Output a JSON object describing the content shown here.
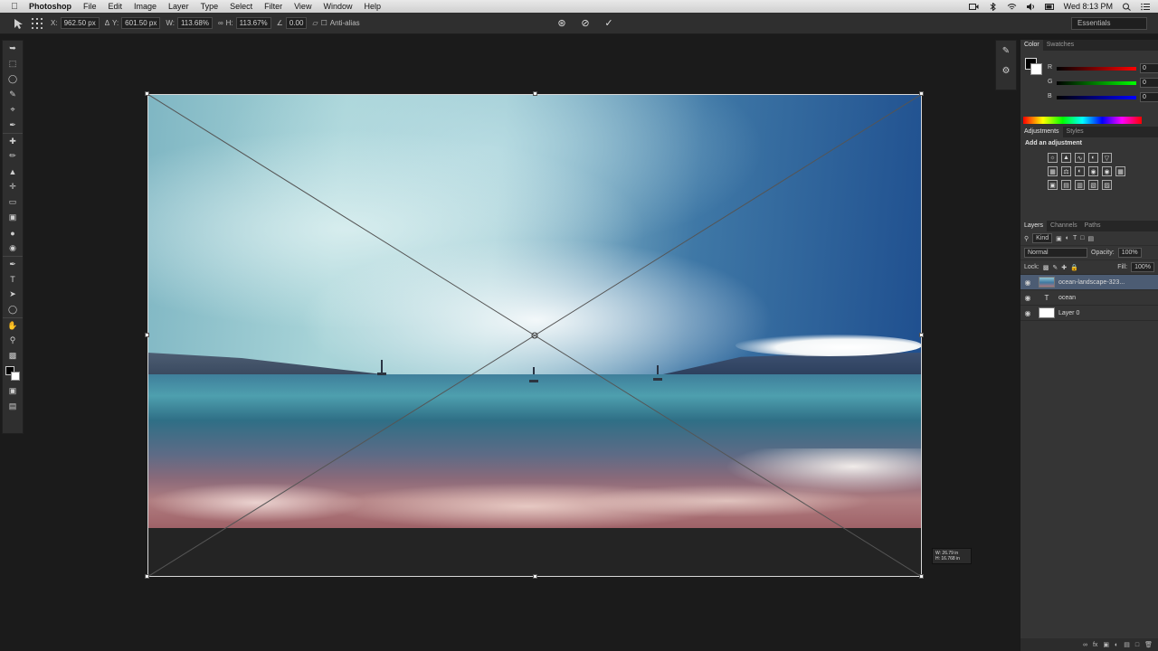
{
  "menubar": {
    "apple": "",
    "items": [
      "Photoshop",
      "File",
      "Edit",
      "Image",
      "Layer",
      "Type",
      "Select",
      "Filter",
      "View",
      "Window",
      "Help"
    ],
    "clock": "Wed 8:13 PM"
  },
  "options": {
    "x_label": "X:",
    "x_value": "962.50 px",
    "y_label": "Y:",
    "y_value": "601.50 px",
    "w_label": "W:",
    "w_value": "113.68%",
    "h_label": "H:",
    "h_value": "113.67%",
    "angle_value": "0.00",
    "antialias_label": "Anti-alias",
    "workspace": "Essentials"
  },
  "readout": {
    "line1": "W: 26.79 in",
    "line2": "H: 16.768 in"
  },
  "color_panel": {
    "tabs": [
      "Color",
      "Swatches"
    ],
    "rows": [
      {
        "label": "R",
        "value": "0",
        "gradient": "linear-gradient(90deg,#000,#ff0000)"
      },
      {
        "label": "G",
        "value": "0",
        "gradient": "linear-gradient(90deg,#000,#00ff00)"
      },
      {
        "label": "B",
        "value": "0",
        "gradient": "linear-gradient(90deg,#000,#0000ff)"
      }
    ]
  },
  "adjustments_panel": {
    "tabs": [
      "Adjustments",
      "Styles"
    ],
    "title": "Add an adjustment"
  },
  "layers_panel": {
    "tabs": [
      "Layers",
      "Channels",
      "Paths"
    ],
    "kind": "Kind",
    "blend_mode": "Normal",
    "opacity_label": "Opacity:",
    "opacity_value": "100%",
    "lock_label": "Lock:",
    "fill_label": "Fill:",
    "fill_value": "100%",
    "layers": [
      {
        "name": "ocean-landscape-323...",
        "type": "image",
        "selected": true
      },
      {
        "name": "ocean",
        "type": "text",
        "selected": false
      },
      {
        "name": "Layer 0",
        "type": "fill",
        "selected": false
      }
    ]
  },
  "colors": {
    "accent_selection": "#4c5c73",
    "app_bg": "#1b1b1b",
    "panel_bg": "#353535"
  }
}
